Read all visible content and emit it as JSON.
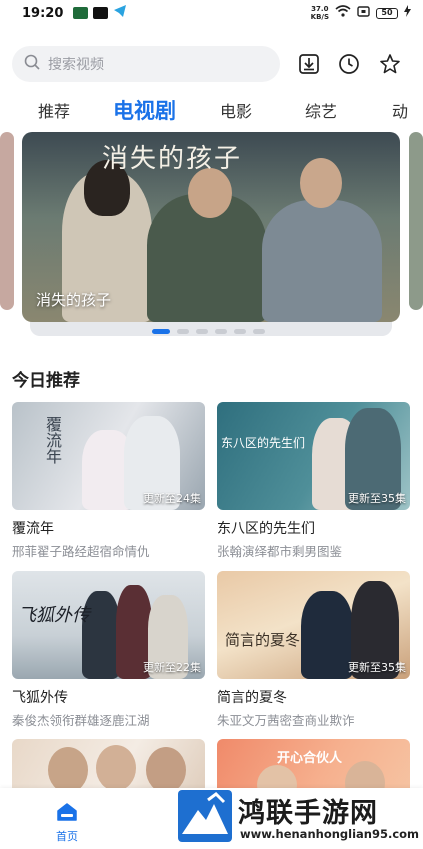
{
  "status_bar": {
    "time": "19:20",
    "network_speed_value": "37.0",
    "network_speed_unit": "KB/S",
    "battery": "50"
  },
  "search": {
    "placeholder": "搜索视频"
  },
  "tabs": [
    {
      "label": "推荐",
      "active": false
    },
    {
      "label": "电视剧",
      "active": true
    },
    {
      "label": "电影",
      "active": false
    },
    {
      "label": "综艺",
      "active": false
    },
    {
      "label": "动",
      "active": false
    }
  ],
  "banner": {
    "poster_title": "消失的孩子",
    "caption": "消失的孩子",
    "page_count": 6,
    "active_page": 0
  },
  "section": {
    "title": "今日推荐"
  },
  "cards": [
    {
      "title": "覆流年",
      "desc": "邢菲翟子路经超宿命情仇",
      "badge": "更新至24集",
      "poster_text": "覆流年"
    },
    {
      "title": "东八区的先生们",
      "desc": "张翰演绎都市剩男图鉴",
      "badge": "更新至35集",
      "poster_text": "东八区的先生们"
    },
    {
      "title": "飞狐外传",
      "desc": "秦俊杰领衔群雄逐鹿江湖",
      "badge": "更新至22集",
      "poster_text": "飞狐外传"
    },
    {
      "title": "简言的夏冬",
      "desc": "朱亚文万茜密查商业欺诈",
      "badge": "更新至35集",
      "poster_text": "简言的夏冬"
    },
    {
      "title": "",
      "desc": "",
      "badge": "",
      "poster_text": ""
    },
    {
      "title": "",
      "desc": "",
      "badge": "",
      "poster_text": "开心合伙人"
    }
  ],
  "bottom_nav": {
    "home_label": "首页"
  },
  "watermark": {
    "title": "鸿联手游网",
    "url": "www.henanhonglian95.com"
  },
  "colors": {
    "accent": "#1a72e8",
    "muted_text": "#8c8f96"
  }
}
